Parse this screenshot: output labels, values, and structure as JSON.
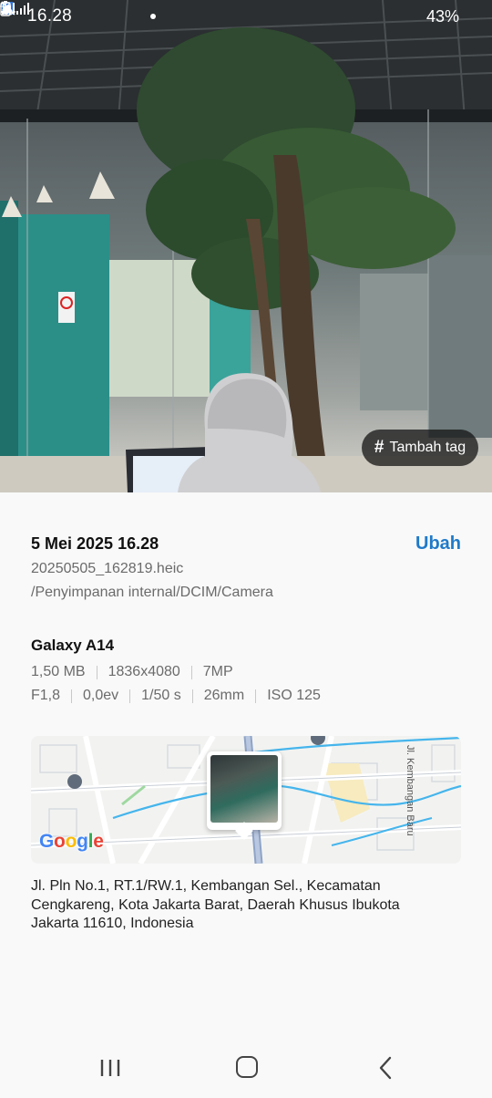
{
  "status_bar": {
    "time": "16.28",
    "battery": "43%",
    "network": "4G",
    "icons_left": [
      "message-icon",
      "missed-call-icon",
      "app-notification-icon",
      "dot-icon"
    ],
    "icons_right": [
      "mute-icon",
      "signal-icon",
      "signal-4g-icon",
      "battery-icon"
    ]
  },
  "photo": {
    "tag_button_label": "Tambah tag",
    "tag_icon": "#"
  },
  "details": {
    "date": "5 Mei 2025 16.28",
    "edit_label": "Ubah",
    "file_name": "20250505_162819.heic",
    "file_path": "/Penyimpanan internal/DCIM/Camera",
    "device": "Galaxy A14",
    "file_size": "1,50 MB",
    "resolution": "1836x4080",
    "megapixels": "7MP",
    "aperture": "F1,8",
    "exposure": "0,0ev",
    "shutter": "1/50 s",
    "focal_length": "26mm",
    "iso": "ISO 125"
  },
  "map": {
    "street_label": "Jl. Kembangan Baru",
    "logo_text": "Google"
  },
  "address": "Jl. Pln No.1, RT.1/RW.1, Kembangan Sel., Kecamatan Cengkareng, Kota Jakarta Barat, Daerah Khusus Ibukota Jakarta 11610, Indonesia",
  "colors": {
    "accent": "#1f7ac9",
    "background": "#f9f9f9",
    "secondary_text": "#6b6b6b"
  }
}
